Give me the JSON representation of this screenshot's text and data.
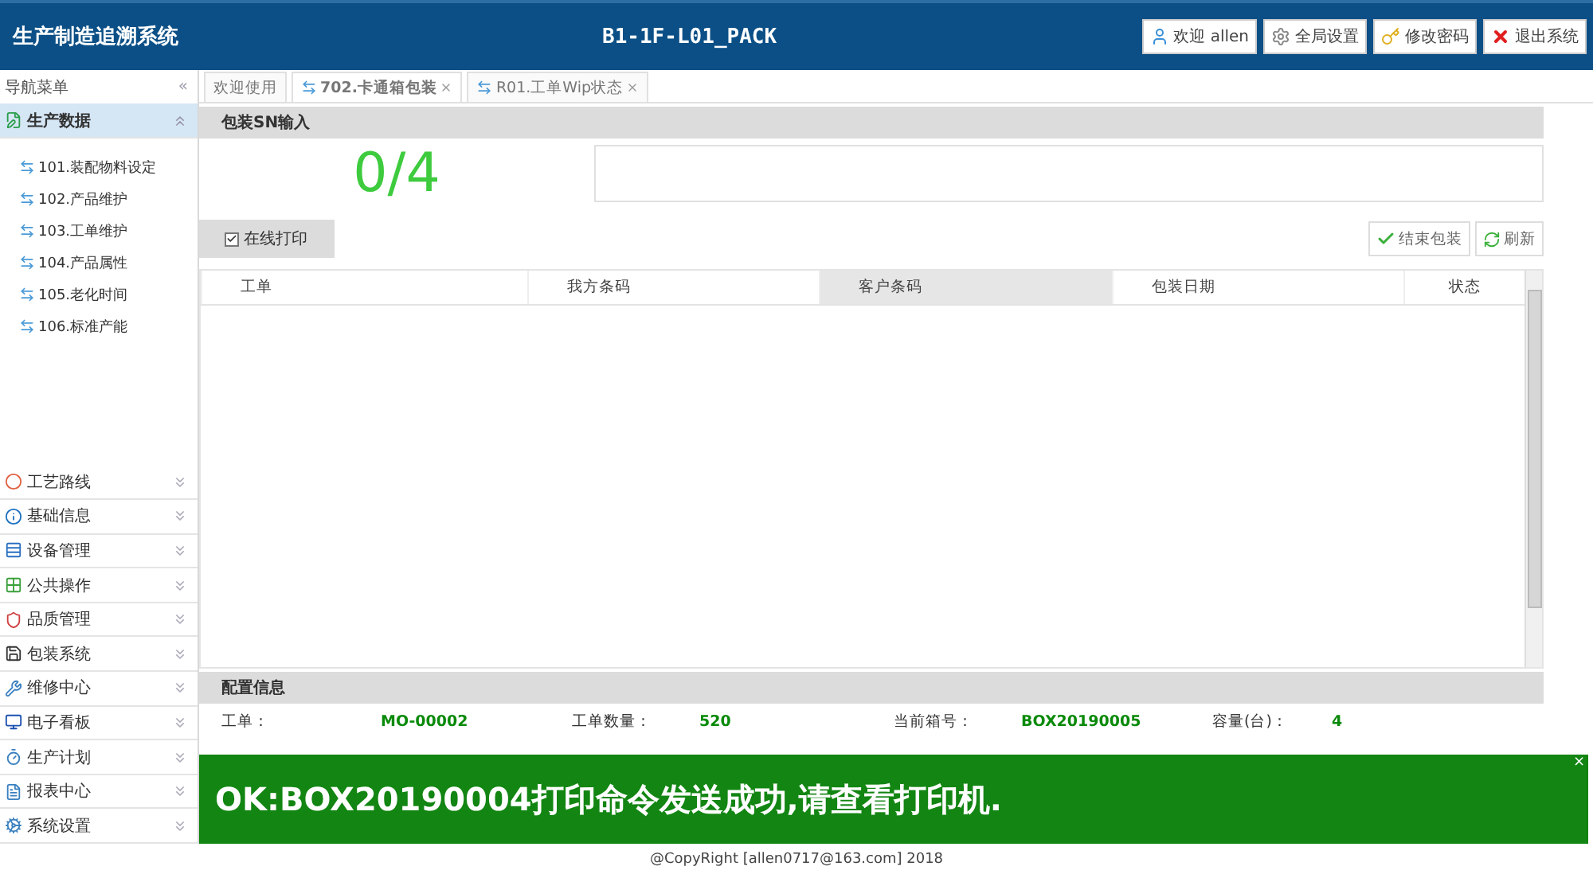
{
  "header": {
    "app_title": "生产制造追溯系统",
    "station": "B1-1F-L01_PACK",
    "buttons": [
      {
        "label": "欢迎 allen"
      },
      {
        "label": "全局设置"
      },
      {
        "label": "修改密码"
      },
      {
        "label": "退出系统"
      }
    ]
  },
  "sidebar": {
    "title": "导航菜单",
    "collapse": "«",
    "groups": [
      {
        "label": "生产数据",
        "expanded": true,
        "selected": true,
        "items": [
          "101.装配物料设定",
          "102.产品维护",
          "103.工单维护",
          "104.产品属性",
          "105.老化时间",
          "106.标准产能"
        ]
      },
      {
        "label": "工艺路线",
        "expanded": false,
        "selected": false
      },
      {
        "label": "基础信息",
        "expanded": false,
        "selected": false
      },
      {
        "label": "设备管理",
        "expanded": false,
        "selected": false
      },
      {
        "label": "公共操作",
        "expanded": false,
        "selected": false
      },
      {
        "label": "品质管理",
        "expanded": false,
        "selected": false
      },
      {
        "label": "包装系统",
        "expanded": false,
        "selected": false
      },
      {
        "label": "维修中心",
        "expanded": false,
        "selected": false
      },
      {
        "label": "电子看板",
        "expanded": false,
        "selected": false
      },
      {
        "label": "生产计划",
        "expanded": false,
        "selected": false
      },
      {
        "label": "报表中心",
        "expanded": false,
        "selected": false
      },
      {
        "label": "系统设置",
        "expanded": false,
        "selected": false
      }
    ]
  },
  "tabs": [
    {
      "label": "欢迎使用",
      "selected": false,
      "closable": false
    },
    {
      "label": "702.卡通箱包装",
      "selected": true,
      "closable": true
    },
    {
      "label": "R01.工单Wip状态",
      "selected": false,
      "closable": true
    }
  ],
  "sn_panel": {
    "title": "包装SN输入",
    "counter": "0/4"
  },
  "online_print": {
    "label": "在线打印",
    "checked": true
  },
  "actions": [
    {
      "label": "结束包装",
      "kind": "finish"
    },
    {
      "label": "刷新",
      "kind": "refresh"
    }
  ],
  "table": {
    "columns": [
      {
        "label": "工单",
        "selected": false
      },
      {
        "label": "我方条码",
        "selected": false
      },
      {
        "label": "客户条码",
        "selected": true
      },
      {
        "label": "包装日期",
        "selected": false
      },
      {
        "label": "状态",
        "selected": false
      }
    ]
  },
  "config": {
    "title": "配置信息",
    "fields": [
      {
        "label": "工单：",
        "value": "MO-00002"
      },
      {
        "label": "工单数量：",
        "value": "520"
      },
      {
        "label": "当前箱号：",
        "value": "BOX20190005"
      },
      {
        "label": "容量(台)：",
        "value": "4"
      }
    ]
  },
  "message": {
    "text": "OK:BOX20190004打印命令发送成功,请查看打印机.",
    "close": "×",
    "kind": "success"
  },
  "footer": "@CopyRight [allen0717@163.com] 2018"
}
